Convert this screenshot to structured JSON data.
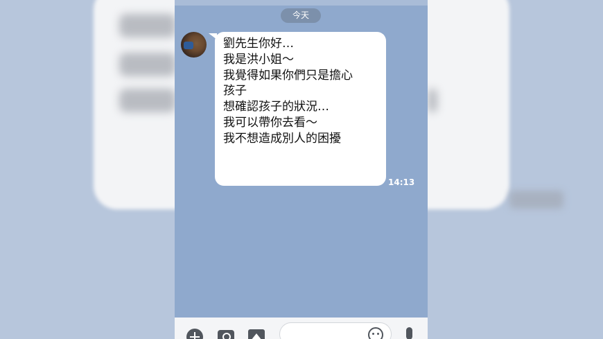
{
  "chat": {
    "date_label": "今天",
    "message": {
      "lines": [
        "劉先生你好…",
        "我是洪小姐～",
        "我覺得如果你們只是擔心",
        "孩子",
        "想確認孩子的狀況…",
        "我可以帶你去看～",
        "我不想造成別人的困擾"
      ],
      "time": "14:13"
    }
  },
  "input_bar": {
    "icons": [
      "plus-icon",
      "camera-icon",
      "image-icon",
      "emoji-icon",
      "mic-icon"
    ],
    "placeholder": ""
  },
  "colors": {
    "chat_background": "#8fa9cd",
    "bubble": "#ffffff",
    "date_pill": "#7c90ab"
  }
}
